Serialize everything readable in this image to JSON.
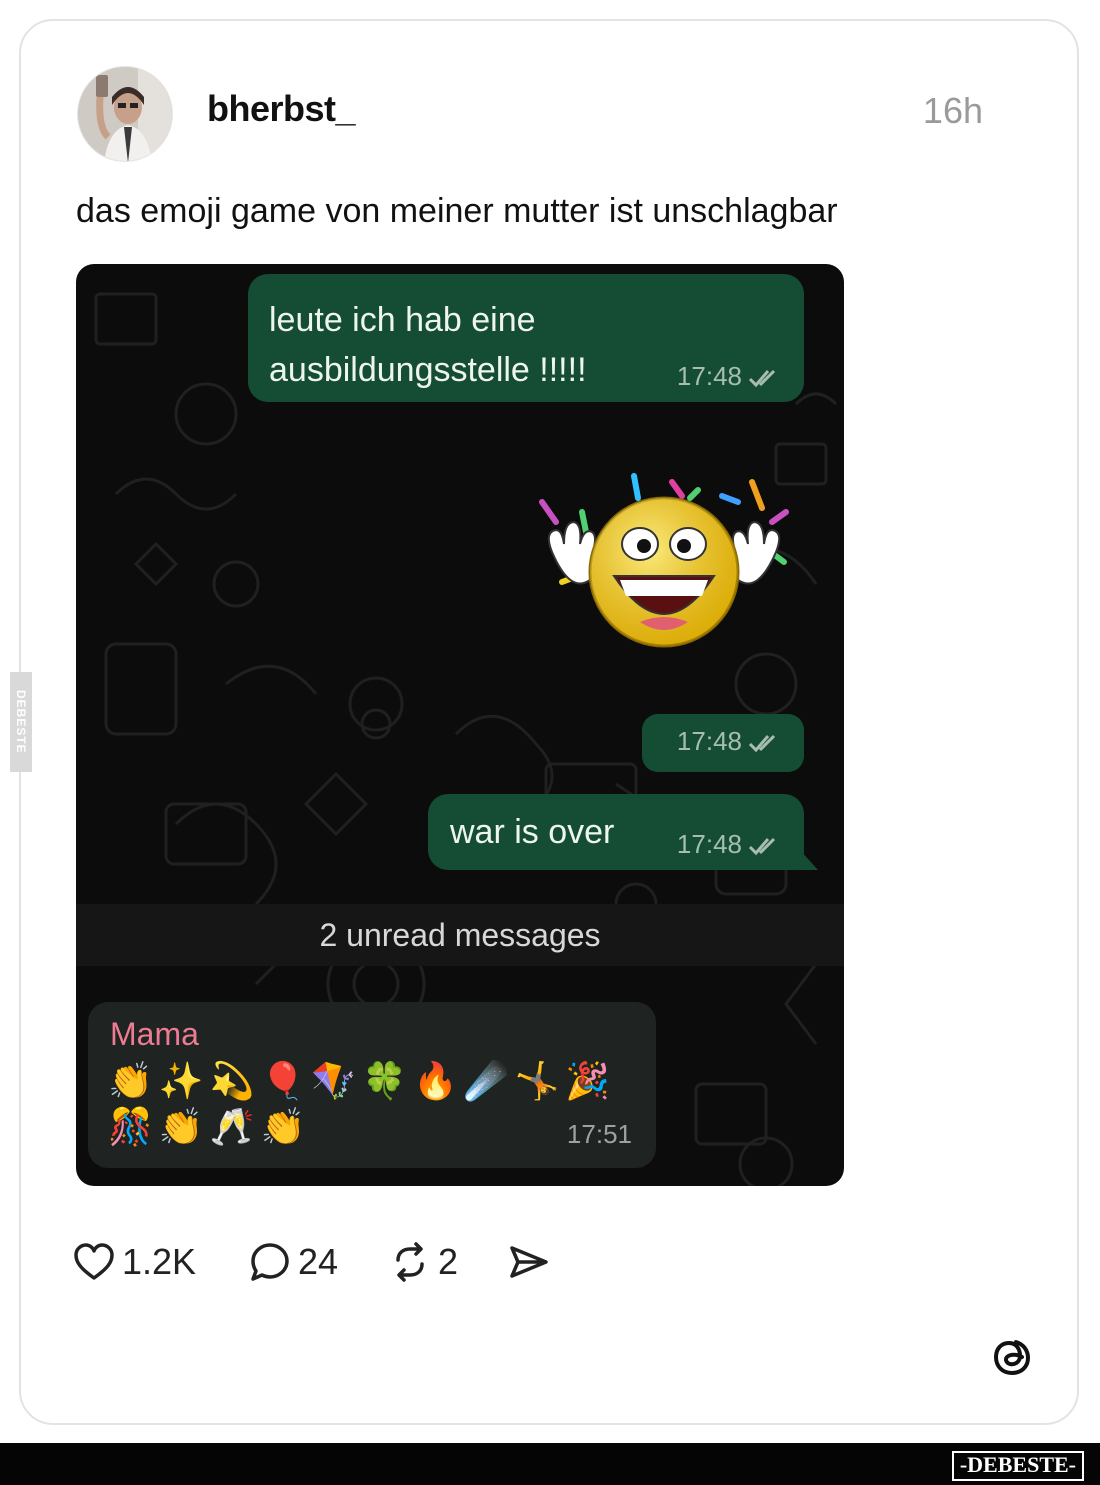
{
  "post": {
    "username": "bherbst_",
    "time": "16h",
    "caption": "das emoji game von meiner mutter ist unschlagbar"
  },
  "chat": {
    "messages_out": [
      {
        "text_line1": "leute ich hab eine",
        "text_line2": "ausbildungsstelle !!!!!",
        "time": "17:48"
      },
      {
        "sticker": "celebrating-smiley-sticker",
        "time": "17:48"
      },
      {
        "text": "war is over",
        "time": "17:48"
      }
    ],
    "unread_label": "2 unread messages",
    "message_in": {
      "sender": "Mama",
      "emoji_line1": "👏✨💫🎈🪁🍀🔥☄️🤸🎉",
      "emoji_line2": "🎊👏🥂👏",
      "time": "17:51"
    },
    "colors": {
      "bubble_out": "#154d34",
      "bubble_in": "#1f2321",
      "sender_name": "#ec7c93",
      "background": "#0b0c0b"
    }
  },
  "actions": {
    "likes": "1.2K",
    "comments": "24",
    "reposts": "2",
    "icons": [
      "heart-icon",
      "comment-icon",
      "repost-icon",
      "share-icon"
    ]
  },
  "watermarks": {
    "side": "DEBESTE",
    "footer": "-DEBESTE-"
  },
  "brand": {
    "logo": "threads-logo-icon"
  }
}
